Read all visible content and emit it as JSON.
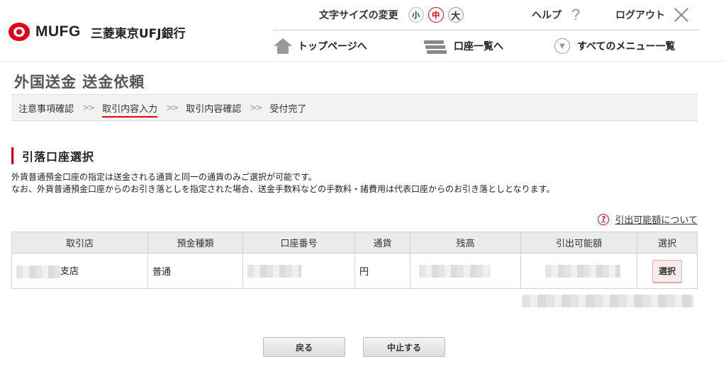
{
  "brand": {
    "logo_text": "MUFG",
    "bank_name": "三菱東京UFJ銀行",
    "accent": "#e60012"
  },
  "header": {
    "font_size_label": "文字サイズの変更",
    "font_sizes": [
      "小",
      "中",
      "大"
    ],
    "font_size_selected": "中",
    "help_label": "ヘルプ",
    "logout_label": "ログアウト",
    "nav": {
      "top": "トップページへ",
      "accounts": "口座一覧へ",
      "menu": "すべてのメニュー一覧"
    }
  },
  "page": {
    "title": "外国送金 送金依頼",
    "steps": [
      "注意事項確認",
      "取引内容入力",
      "取引内容確認",
      "受付完了"
    ],
    "current_step": "取引内容入力"
  },
  "section": {
    "title": "引落口座選択",
    "desc_line1": "外貨普通預金口座の指定は送金される通貨と同一の通貨のみご選択が可能です。",
    "desc_line2": "なお、外貨普通預金口座からのお引き落としを指定された場合、送金手数料などの手数料・諸費用は代表口座からのお引き落としとなります。",
    "limit_link": "引出可能額について"
  },
  "table": {
    "headers": [
      "取引店",
      "預金種類",
      "口座番号",
      "通貨",
      "残高",
      "引出可能額",
      "選択"
    ],
    "row": {
      "branch_suffix": "支店",
      "type": "普通",
      "currency": "円",
      "select_label": "選択"
    }
  },
  "buttons": {
    "back": "戻る",
    "cancel": "中止する"
  }
}
